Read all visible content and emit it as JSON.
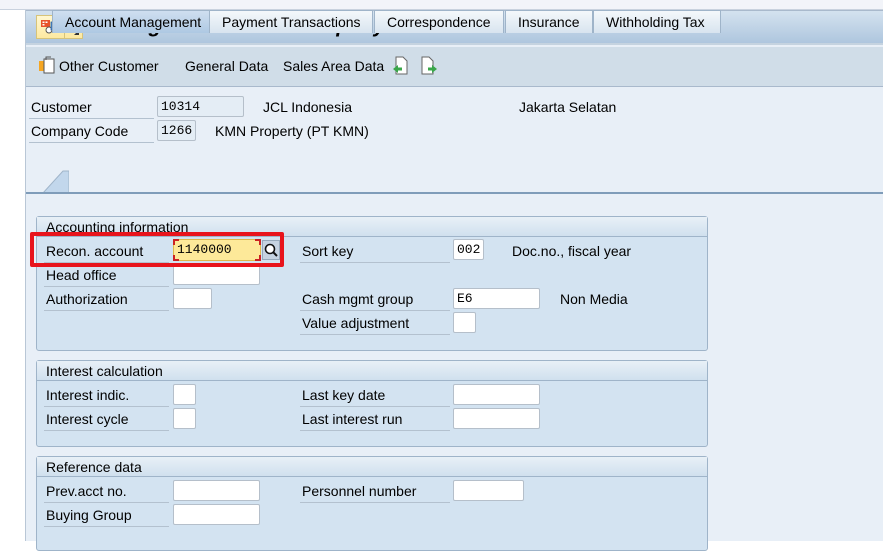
{
  "window": {
    "title": "Change Customer: Company Code Data"
  },
  "toolbar": {
    "items": [
      {
        "label": "Other Customer",
        "icon": "other-customer-icon"
      },
      {
        "label": "General Data"
      },
      {
        "label": "Sales Area Data"
      },
      {
        "icon": "previous-screen-icon"
      },
      {
        "icon": "next-screen-icon"
      }
    ]
  },
  "header": {
    "customer": {
      "label": "Customer",
      "value": "10314",
      "name": "JCL Indonesia",
      "city": "Jakarta Selatan"
    },
    "company_code": {
      "label": "Company Code",
      "value": "1266",
      "name": "KMN Property (PT KMN)"
    }
  },
  "tabs": [
    {
      "label": "Account Management",
      "active": true
    },
    {
      "label": "Payment Transactions",
      "active": false
    },
    {
      "label": "Correspondence",
      "active": false
    },
    {
      "label": "Insurance",
      "active": false
    },
    {
      "label": "Withholding Tax",
      "active": false
    }
  ],
  "groups": {
    "accounting": {
      "title": "Accounting information",
      "recon_account": {
        "label": "Recon. account",
        "value": "1140000"
      },
      "head_office": {
        "label": "Head office",
        "value": ""
      },
      "authorization": {
        "label": "Authorization",
        "value": ""
      },
      "sort_key": {
        "label": "Sort key",
        "value": "002",
        "description": "Doc.no., fiscal year"
      },
      "cash_mgmt_group": {
        "label": "Cash mgmt group",
        "value": "E6",
        "description": "Non Media"
      },
      "value_adjustment": {
        "label": "Value adjustment",
        "value": ""
      }
    },
    "interest": {
      "title": "Interest calculation",
      "interest_indic": {
        "label": "Interest indic.",
        "value": ""
      },
      "interest_cycle": {
        "label": "Interest cycle",
        "value": ""
      },
      "last_key_date": {
        "label": "Last key date",
        "value": ""
      },
      "last_interest_run": {
        "label": "Last interest run",
        "value": ""
      }
    },
    "reference": {
      "title": "Reference data",
      "prev_acct_no": {
        "label": "Prev.acct no.",
        "value": ""
      },
      "buying_group": {
        "label": "Buying Group",
        "value": ""
      },
      "personnel_number": {
        "label": "Personnel number",
        "value": ""
      }
    }
  },
  "highlight": {
    "color": "#e8141c",
    "target": "recon_account"
  }
}
